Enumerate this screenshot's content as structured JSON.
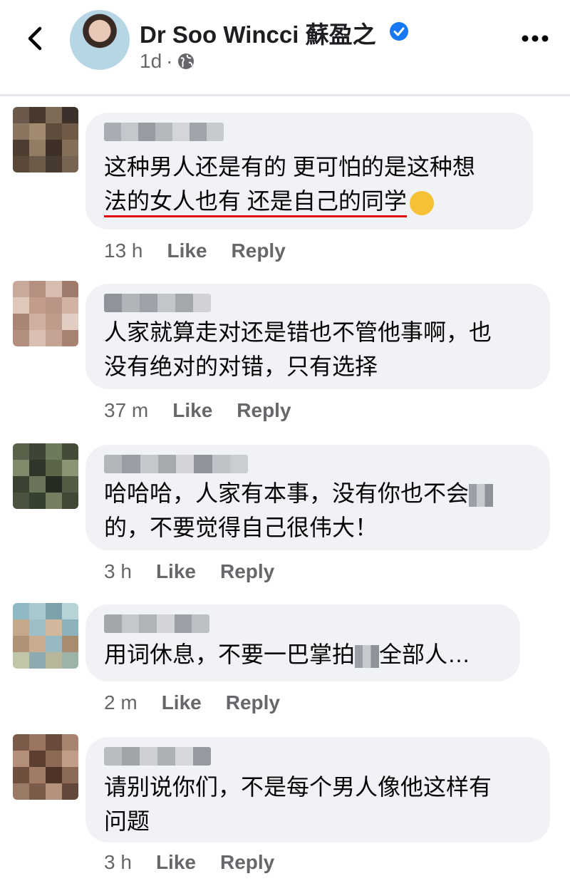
{
  "header": {
    "name": "Dr Soo Wincci 蘇盈之",
    "time": "1d",
    "separator": "·",
    "icons": {
      "back": "chevron-left-icon",
      "verified": "verified-badge-icon",
      "privacy": "globe-icon",
      "more": "more-options-icon"
    }
  },
  "labels": {
    "like": "Like",
    "reply": "Reply"
  },
  "colors": {
    "bubble": "#f0f2f5",
    "underline": "#e0000a",
    "meta": "#65676b",
    "verified": "#1877f2"
  },
  "comments": [
    {
      "lines": [
        "这种男人还是有的 更可怕的是这种想",
        "法的女人也有 还是自己的同学"
      ],
      "emoji": "grinning-sweat-emoji",
      "time": "13 h"
    },
    {
      "lines": [
        "人家就算走对还是错也不管他事啊，也",
        "没有绝对的对错，只有选择"
      ],
      "time": "37 m"
    },
    {
      "lines": [
        "哈哈哈，人家有本事，没有你也不会",
        "的，不要觉得自己很伟大！"
      ],
      "time": "3 h"
    },
    {
      "lines": [
        "用词休息，不要一巴掌拍",
        "全部人…"
      ],
      "time": "2 m"
    },
    {
      "lines": [
        "请别说你们，不是每个男人像他这样有",
        "问题"
      ],
      "time": "3 h"
    }
  ]
}
